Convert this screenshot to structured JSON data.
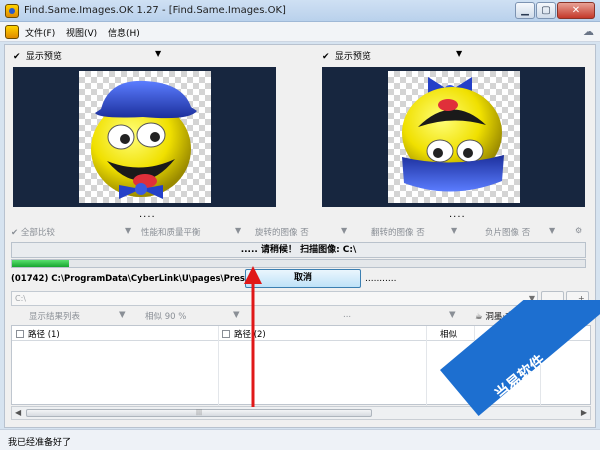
{
  "window": {
    "title": "Find.Same.Images.OK 1.27 - [Find.Same.Images.OK]",
    "controls": {
      "minimize": "▁",
      "maximize": "▢",
      "close": "✕"
    }
  },
  "menu": {
    "items": [
      "文件(F)",
      "视图(V)",
      "信息(H)"
    ]
  },
  "preview": {
    "left_label": "显示预览",
    "right_label": "显示预览",
    "left_dots": "....",
    "right_dots": "...."
  },
  "options": {
    "items": [
      "全部比较",
      "性能和质量平衡",
      "旋转的图像 否",
      "翻转的图像 否",
      "负片图像 否"
    ]
  },
  "scan": {
    "status": "..... 请稍候！ 扫描图像: C:\\",
    "progress": 0.1,
    "current_path": "(01742)  C:\\ProgramData\\CyberLink\\U\\pages\\Pres",
    "cancel_label": "取消",
    "trailing_dots": "..........."
  },
  "path_field": {
    "value": "C:\\"
  },
  "path_buttons": [
    "...",
    "...+"
  ],
  "filters": {
    "items": [
      "显示结果列表",
      "相似 90 %",
      "..."
    ],
    "right_label": "洞墨·支持我的工作:"
  },
  "table": {
    "columns": [
      "路径 (1)",
      "路径 (2)",
      "相似",
      "Ratio %",
      "大"
    ]
  },
  "status": {
    "text": "我已经准备好了"
  },
  "watermark": {
    "text": "当易软件"
  },
  "colors": {
    "accent": "#1d6fd0",
    "progress": "#17a52f",
    "preview_bg": "#17263f"
  }
}
